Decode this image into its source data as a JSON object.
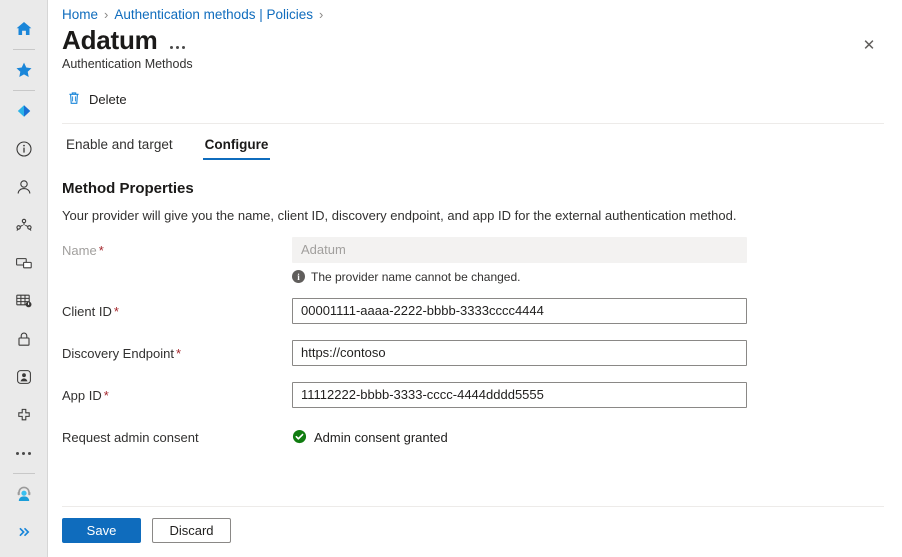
{
  "rail": {
    "items": [
      {
        "name": "home-icon",
        "label": "Home"
      },
      {
        "name": "favorites-star-icon",
        "label": "Favorites"
      },
      {
        "name": "entra-diamond-icon",
        "label": "Microsoft Entra ID"
      },
      {
        "name": "info-circle-icon",
        "label": "Overview"
      },
      {
        "name": "user-icon",
        "label": "Users"
      },
      {
        "name": "groups-icon",
        "label": "Groups"
      },
      {
        "name": "devices-icon",
        "label": "Devices"
      },
      {
        "name": "applications-grid-icon",
        "label": "Applications"
      },
      {
        "name": "lock-icon",
        "label": "Protection"
      },
      {
        "name": "identity-governance-icon",
        "label": "Identity governance"
      },
      {
        "name": "health-icon",
        "label": "Health"
      },
      {
        "name": "more-ellipsis-icon",
        "label": "Show more"
      },
      {
        "name": "support-agent-icon",
        "label": "Support"
      },
      {
        "name": "expand-chevrons-icon",
        "label": "Expand"
      }
    ]
  },
  "breadcrumb": {
    "items": [
      "Home",
      "Authentication methods | Policies"
    ],
    "separator": "›"
  },
  "header": {
    "title": "Adatum",
    "subtitle": "Authentication Methods",
    "close_label": "✕"
  },
  "toolbar": {
    "delete_label": "Delete"
  },
  "tabs": [
    {
      "label": "Enable and target",
      "active": false
    },
    {
      "label": "Configure",
      "active": true
    }
  ],
  "section": {
    "title": "Method Properties",
    "description": "Your provider will give you the name, client ID, discovery endpoint, and app ID for the external authentication method."
  },
  "form": {
    "name": {
      "label": "Name",
      "required": true,
      "value": "Adatum",
      "disabled": true,
      "hint": "The provider name cannot be changed."
    },
    "client_id": {
      "label": "Client ID",
      "required": true,
      "value": "00001111-aaaa-2222-bbbb-3333cccc4444"
    },
    "discovery_endpoint": {
      "label": "Discovery Endpoint",
      "required": true,
      "value": "https://contoso"
    },
    "app_id": {
      "label": "App ID",
      "required": true,
      "value": "11112222-bbbb-3333-cccc-4444dddd5555"
    },
    "admin_consent": {
      "label": "Request admin consent",
      "status_text": "Admin consent granted"
    },
    "required_marker": "*"
  },
  "footer": {
    "save_label": "Save",
    "discard_label": "Discard"
  },
  "colors": {
    "accent": "#0f6cbd",
    "link": "#0f6cbd",
    "required": "#a4262c",
    "success": "#107c10",
    "rail_bg": "#eaeaea"
  }
}
